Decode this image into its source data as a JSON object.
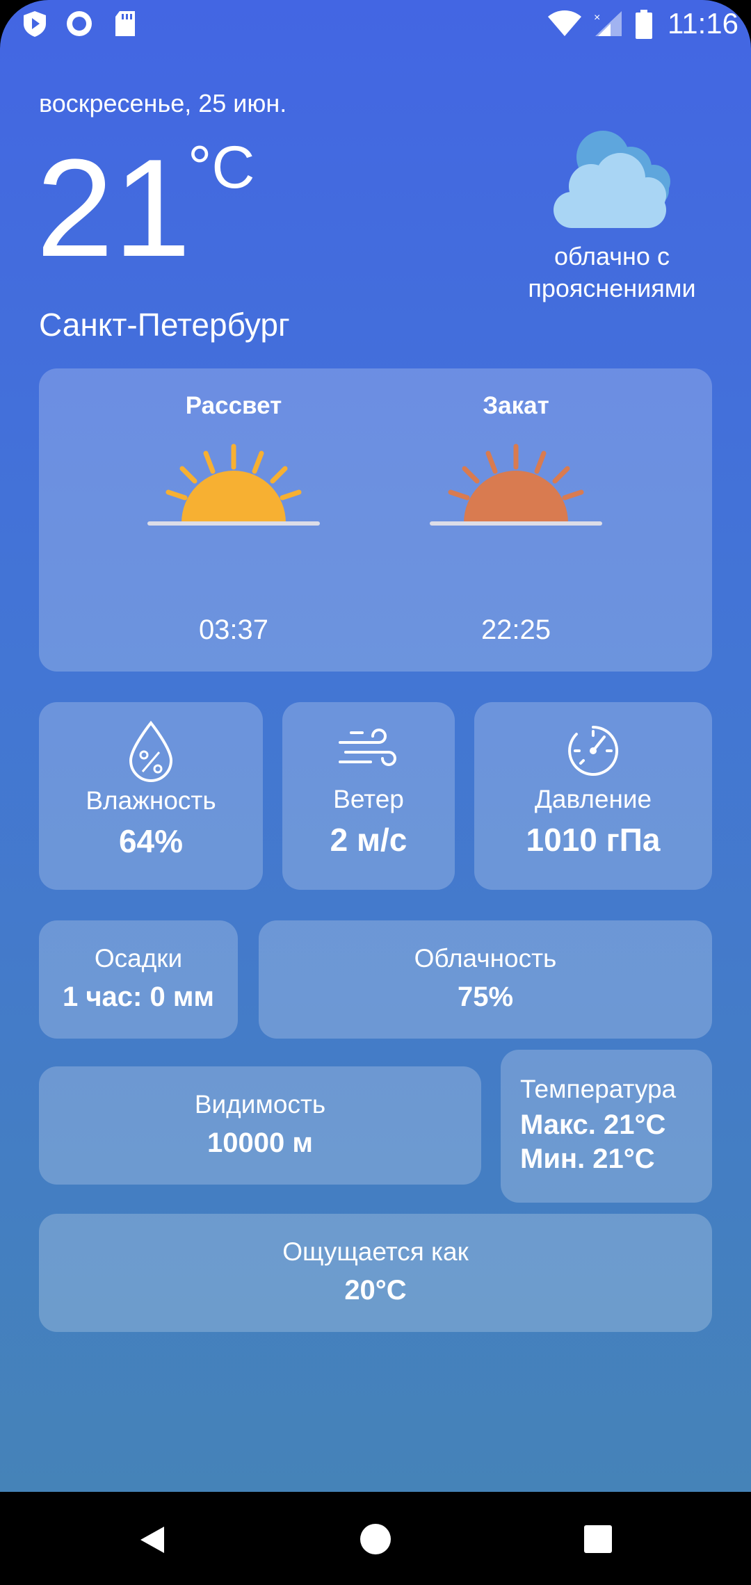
{
  "status_bar": {
    "time": "11:16"
  },
  "header": {
    "date": "воскресенье, 25 июн.",
    "temperature": "21",
    "unit": "°C",
    "condition": "облачно с прояснениями",
    "city": "Санкт-Петербург"
  },
  "sun": {
    "sunrise_label": "Рассвет",
    "sunrise_time": "03:37",
    "sunset_label": "Закат",
    "sunset_time": "22:25",
    "sunrise_color": "#f7b032",
    "sunset_color": "#d97b50"
  },
  "metrics": {
    "humidity": {
      "label": "Влажность",
      "value": "64%"
    },
    "wind": {
      "label": "Ветер",
      "value": "2 м/с"
    },
    "pressure": {
      "label": "Давление",
      "value": "1010 гПа"
    },
    "precipitation": {
      "label": "Осадки",
      "value": "1 час: 0 мм"
    },
    "cloudiness": {
      "label": "Облачность",
      "value": "75%"
    },
    "visibility": {
      "label": "Видимость",
      "value": "10000 м"
    },
    "temperature_range": {
      "label": "Температура",
      "max": "Макс. 21°C",
      "min": "Мин. 21°C"
    },
    "feels_like": {
      "label": "Ощущается как",
      "value": "20°C"
    }
  },
  "icons": {
    "status_left": [
      "shield-icon",
      "record-icon",
      "sd-card-icon"
    ],
    "status_right": [
      "wifi-icon",
      "signal-icon",
      "battery-icon"
    ],
    "weather": "partly-cloudy-icon",
    "nav": [
      "back-icon",
      "home-icon",
      "recents-icon"
    ]
  }
}
